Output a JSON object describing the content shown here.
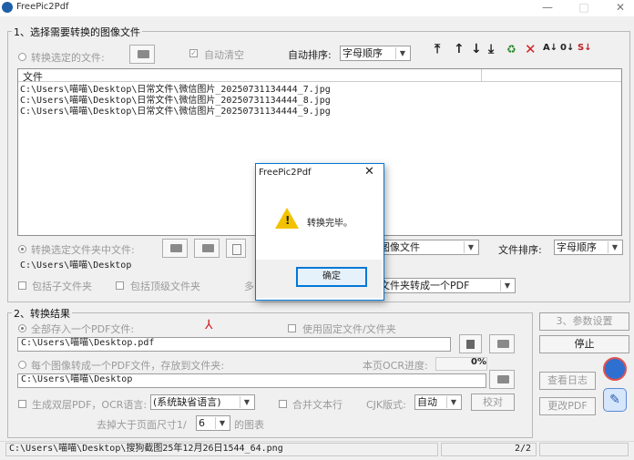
{
  "window": {
    "title": "FreePic2Pdf",
    "min": "—",
    "max": "□",
    "close": "✕"
  },
  "section1": {
    "legend": "1、选择需要转换的图像文件",
    "convert_selected_files": "转换选定的文件:",
    "auto_clear": "自动清空",
    "auto_sort_label": "自动排序:",
    "auto_sort_value": "字母顺序",
    "list_header": "文件",
    "files": [
      "C:\\Users\\喵喵\\Desktop\\日常文件\\微信图片_20250731134444_7.jpg",
      "C:\\Users\\喵喵\\Desktop\\日常文件\\微信图片_20250731134444_8.jpg",
      "C:\\Users\\喵喵\\Desktop\\日常文件\\微信图片_20250731134444_9.jpg"
    ],
    "convert_folder_files": "转换选定文件夹中文件:",
    "folder_filter_value": "图像文件",
    "file_sort_label": "文件排序:",
    "file_sort_value": "字母顺序",
    "folder_path": "C:\\Users\\喵喵\\Desktop",
    "include_subfolders": "包括子文件夹",
    "include_top_folder": "包括顶级文件夹",
    "multi_prefix": "多",
    "folder_mode_value": "文件夹转成一个PDF"
  },
  "section2": {
    "legend": "2、转换结果",
    "all_into_one_pdf": "全部存入一个PDF文件:",
    "use_fixed_file": "使用固定文件/文件夹",
    "pdf_path": "C:\\Users\\喵喵\\Desktop.pdf",
    "each_image_to_pdf": "每个图像转成一个PDF文件，存放到文件夹:",
    "ocr_progress_label": "本页OCR进度:",
    "ocr_progress_value": "0%",
    "output_folder": "C:\\Users\\喵喵\\Desktop",
    "dual_layer_pdf": "生成双层PDF，OCR语言:",
    "ocr_language_value": "(系统缺省语言)",
    "merge_text_lines": "合并文本行",
    "cjk_layout_label": "CJK版式:",
    "cjk_layout_value": "自动",
    "proofread_button": "校对",
    "remove_large_prefix": "去掉大于页面尺寸1/",
    "remove_large_value": "6",
    "remove_large_suffix": "的图表"
  },
  "side": {
    "settings_button": "3、参数设置",
    "stop_button": "停止",
    "view_log_button": "查看日志",
    "change_pdf_button": "更改PDF"
  },
  "toolbar_icons": [
    "move-top",
    "move-up",
    "move-down",
    "move-bottom",
    "clear",
    "delete",
    "sort-az",
    "sort-num",
    "sort-custom"
  ],
  "status": {
    "left": "C:\\Users\\喵喵\\Desktop\\搜狗截图25年12月26日1544_64.png",
    "page": "2/2"
  },
  "dialog": {
    "title": "FreePic2Pdf",
    "message": "转换完毕。",
    "ok_button": "确定",
    "close": "✕"
  },
  "colors": {
    "accent_red": "#d32020",
    "dialog_border": "#0078d7"
  }
}
